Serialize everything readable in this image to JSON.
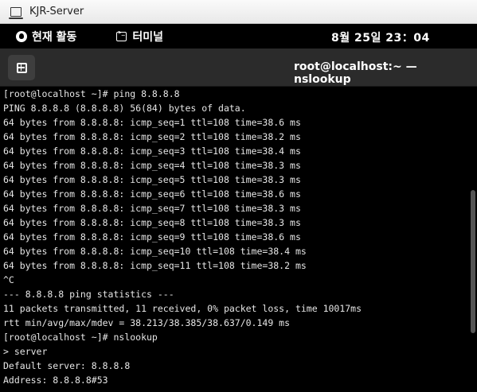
{
  "window": {
    "title": "KJR-Server"
  },
  "topbar": {
    "activities_label": "현재 활동",
    "app_label": "터미널",
    "clock": "8월 25일  23：04"
  },
  "terminal": {
    "title": "root@localhost:~ — nslookup",
    "lines": [
      "[root@localhost ~]# ping 8.8.8.8",
      "PING 8.8.8.8 (8.8.8.8) 56(84) bytes of data.",
      "64 bytes from 8.8.8.8: icmp_seq=1 ttl=108 time=38.6 ms",
      "64 bytes from 8.8.8.8: icmp_seq=2 ttl=108 time=38.2 ms",
      "64 bytes from 8.8.8.8: icmp_seq=3 ttl=108 time=38.4 ms",
      "64 bytes from 8.8.8.8: icmp_seq=4 ttl=108 time=38.3 ms",
      "64 bytes from 8.8.8.8: icmp_seq=5 ttl=108 time=38.3 ms",
      "64 bytes from 8.8.8.8: icmp_seq=6 ttl=108 time=38.6 ms",
      "64 bytes from 8.8.8.8: icmp_seq=7 ttl=108 time=38.3 ms",
      "64 bytes from 8.8.8.8: icmp_seq=8 ttl=108 time=38.3 ms",
      "64 bytes from 8.8.8.8: icmp_seq=9 ttl=108 time=38.6 ms",
      "64 bytes from 8.8.8.8: icmp_seq=10 ttl=108 time=38.4 ms",
      "64 bytes from 8.8.8.8: icmp_seq=11 ttl=108 time=38.2 ms",
      "^C",
      "--- 8.8.8.8 ping statistics ---",
      "11 packets transmitted, 11 received, 0% packet loss, time 10017ms",
      "rtt min/avg/max/mdev = 38.213/38.385/38.637/0.149 ms",
      "[root@localhost ~]# nslookup",
      "> server",
      "Default server: 8.8.8.8",
      "Address: 8.8.8.8#53"
    ]
  },
  "icons": {
    "window_icon": "monitor-icon",
    "activities_icon": "gnome-foot-icon",
    "app_icon": "terminal-icon",
    "new_tab_icon": "new-tab-icon"
  },
  "colors": {
    "terminal_bg": "#000000",
    "terminal_fg": "#e6e6e6",
    "topbar_bg": "#000000",
    "header_bg": "#2b2b2b"
  }
}
